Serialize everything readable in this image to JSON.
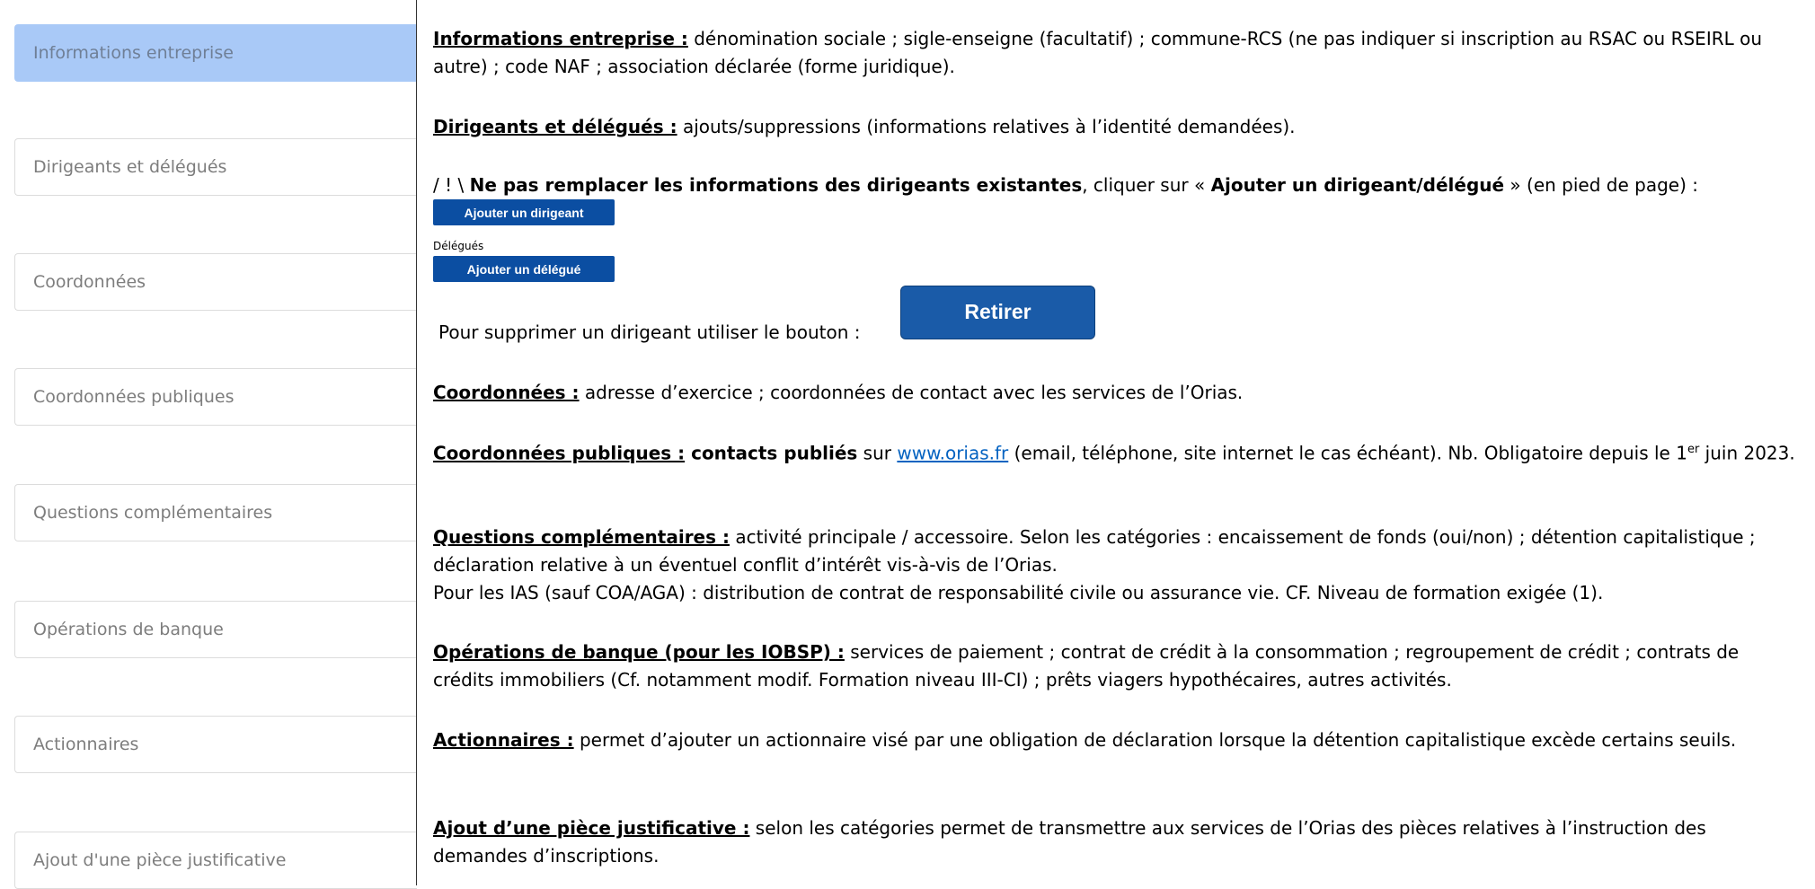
{
  "sidebar": {
    "items": [
      {
        "label": "Informations entreprise",
        "active": true
      },
      {
        "label": "Dirigeants et délégués"
      },
      {
        "label": "Coordonnées"
      },
      {
        "label": "Coordonnées publiques"
      },
      {
        "label": "Questions complémentaires"
      },
      {
        "label": "Opérations de banque"
      },
      {
        "label": "Actionnaires"
      },
      {
        "label": "Ajout d'une pièce justificative"
      }
    ]
  },
  "content": {
    "info": {
      "title": "Informations entreprise :",
      "text": " dénomination sociale ; sigle-enseigne (facultatif) ; commune-RCS (ne pas indiquer si inscription au RSAC ou RSEIRL ou autre) ; code NAF ; association déclarée (forme juridique)."
    },
    "dirigeants": {
      "title": "Dirigeants et délégués :",
      "text": " ajouts/suppressions (informations relatives à l’identité demandées)."
    },
    "warning": {
      "prefix": "/ ! \\ ",
      "bold1": "Ne pas remplacer les informations des dirigeants existantes",
      "mid": ", cliquer sur « ",
      "bold2": "Ajouter un dirigeant/délégué",
      "suffix": " » (en pied de page) :"
    },
    "btn_add_dirigeant": "Ajouter un dirigeant",
    "delegues_label": "Délégués",
    "btn_add_delegue": "Ajouter un délégué",
    "remove_text": "Pour supprimer un dirigeant utiliser le bouton :",
    "btn_remove": "Retirer",
    "coord": {
      "title": "Coordonnées :",
      "text": " adresse d’exercice ; coordonnées de contact avec les services de l’Orias."
    },
    "coord_pub": {
      "title": "Coordonnées publiques :",
      "bold": " contacts publiés",
      "pre_link": " sur ",
      "link": "www.orias.fr",
      "text": " (email, téléphone, site internet le cas échéant). Nb. Obligatoire depuis le 1",
      "sup": "er",
      "text2": " juin 2023."
    },
    "questions": {
      "title": "Questions complémentaires :",
      "text": " activité principale / accessoire. Selon les catégories : encaissement de fonds (oui/non) ; détention capitalistique ; déclaration relative à un éventuel conflit d’intérêt vis-à-vis de l’Orias.",
      "text2": "Pour les IAS (sauf COA/AGA) : distribution de contrat de responsabilité civile ou assurance vie. CF. Niveau de formation exigée (1)."
    },
    "banque": {
      "title": "Opérations de banque (pour les IOBSP) :",
      "text": " services de paiement ; contrat de crédit à la consommation ; regroupement de crédit ; contrats de crédits immobiliers (Cf. notamment modif. Formation niveau III-CI) ; prêts viagers hypothécaires, autres activités."
    },
    "actionnaires": {
      "title": "Actionnaires :",
      "text": " permet d’ajouter un actionnaire visé par une obligation de déclaration lorsque la détention capitalistique excède certains seuils."
    },
    "piece": {
      "title": "Ajout d’une pièce justificative :",
      "text": " selon les catégories permet de transmettre aux services de l’Orias des pièces relatives à l’instruction des demandes d’inscriptions."
    }
  }
}
